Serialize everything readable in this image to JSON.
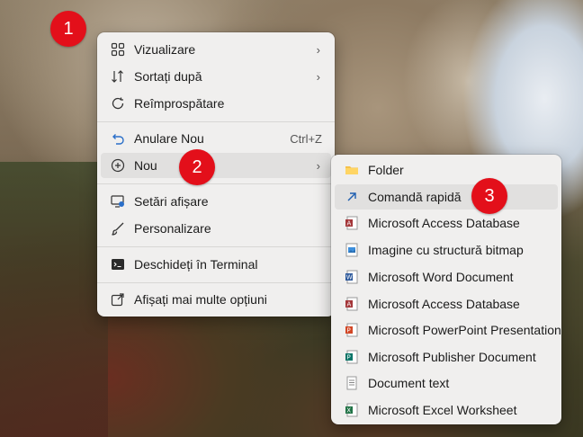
{
  "badges": [
    "1",
    "2",
    "3"
  ],
  "context_menu": {
    "items": [
      {
        "label": "Vizualizare",
        "icon": "grid-icon",
        "submenu": true
      },
      {
        "label": "Sortați după",
        "icon": "sort-icon",
        "submenu": true
      },
      {
        "label": "Reîmprospătare",
        "icon": "refresh-icon"
      },
      {
        "label": "Anulare Nou",
        "icon": "undo-icon",
        "shortcut": "Ctrl+Z"
      },
      {
        "label": "Nou",
        "icon": "new-icon",
        "submenu": true
      },
      {
        "label": "Setări afișare",
        "icon": "display-settings-icon"
      },
      {
        "label": "Personalizare",
        "icon": "brush-icon"
      },
      {
        "label": "Deschideți în Terminal",
        "icon": "terminal-icon"
      },
      {
        "label": "Afișați mai multe opțiuni",
        "icon": "more-options-icon"
      }
    ],
    "arrow_glyph": "›"
  },
  "submenu": {
    "items": [
      {
        "label": "Folder",
        "icon": "folder-icon"
      },
      {
        "label": "Comandă rapidă",
        "icon": "shortcut-icon"
      },
      {
        "label": "Microsoft Access Database",
        "icon": "access-icon"
      },
      {
        "label": "Imagine cu structură bitmap",
        "icon": "bitmap-icon"
      },
      {
        "label": "Microsoft Word Document",
        "icon": "word-icon"
      },
      {
        "label": "Microsoft Access Database",
        "icon": "access-icon"
      },
      {
        "label": "Microsoft PowerPoint Presentation",
        "icon": "powerpoint-icon"
      },
      {
        "label": "Microsoft Publisher Document",
        "icon": "publisher-icon"
      },
      {
        "label": "Document text",
        "icon": "text-document-icon"
      },
      {
        "label": "Microsoft Excel Worksheet",
        "icon": "excel-icon"
      }
    ]
  },
  "colors": {
    "badge": "#e30f1a",
    "menu_bg": "#f0efee",
    "highlight": "#e1e0df"
  }
}
